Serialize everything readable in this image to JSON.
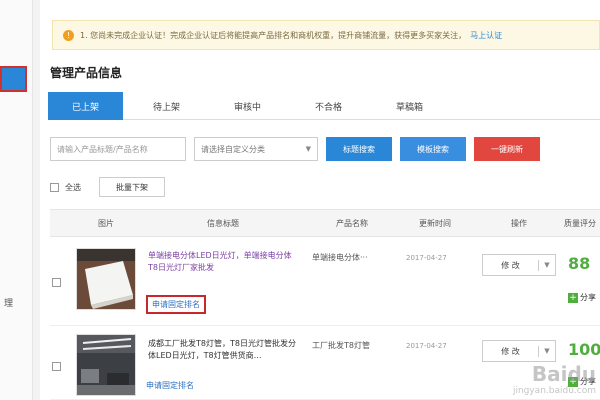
{
  "notice": {
    "text": "1. 您尚未完成企业认证！完成企业认证后将能提高产品排名和商机权重，提升商铺流量，获得更多买家关注，",
    "link": "马上认证"
  },
  "page_title": "管理产品信息",
  "tabs": [
    {
      "label": "已上架",
      "active": true
    },
    {
      "label": "待上架",
      "active": false
    },
    {
      "label": "审核中",
      "active": false
    },
    {
      "label": "不合格",
      "active": false
    },
    {
      "label": "草稿箱",
      "active": false
    }
  ],
  "search": {
    "placeholder": "请输入产品标题/产品名称",
    "category": "请选择自定义分类",
    "btn_by_title": "标题搜索",
    "btn_by_template": "模板搜索",
    "btn_refresh": "一键刷新"
  },
  "bulk": {
    "select_all": "全选",
    "bulk_off": "批量下架"
  },
  "table": {
    "headers": [
      "图片",
      "信息标题",
      "产品名称",
      "更新时间",
      "操作",
      "质量评分"
    ]
  },
  "rows": [
    {
      "title": "单端接电分体LED日光灯，单端接电分体T8日光灯厂家批发",
      "apply": "申请固定排名",
      "name": "单端接电分体···",
      "time": "2017-04-27",
      "op": "修 改",
      "score": "88",
      "share": "分享"
    },
    {
      "title": "成都工厂批发T8灯管，T8日光灯管批发分体LED日光灯，T8灯管供货商…",
      "apply": "申请固定排名",
      "name": "工厂批发T8灯管",
      "time": "2017-04-27",
      "op": "修 改",
      "score": "100",
      "share": "分享"
    }
  ],
  "sidebar": {
    "item_text": "理"
  },
  "watermark": {
    "brand": "Baidu",
    "domain": "jingyan.baidu.com"
  },
  "colors": {
    "accent": "#2a87d8",
    "danger": "#e2473f",
    "score": "#4fae3e",
    "highlight_box": "#c8282b"
  }
}
